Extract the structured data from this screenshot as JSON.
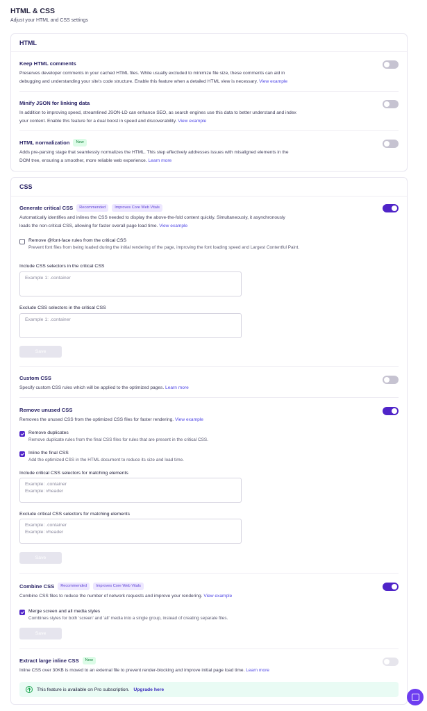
{
  "page": {
    "title": "HTML & CSS",
    "subtitle": "Adjust your HTML and CSS settings"
  },
  "html_section": {
    "title": "HTML",
    "options": [
      {
        "title": "Keep HTML comments",
        "desc_line1": "Preserves developer comments in your cached HTML files. While usually excluded to minimize file size, these comments can aid in",
        "desc_line2": "debugging and understanding your site's code structure. Enable this feature when a detailed HTML view is necessary.",
        "link": "View example",
        "enabled": false
      },
      {
        "title": "Minify JSON for linking data",
        "desc_line1": "In addition to improving speed, streamlined JSON-LD can enhance SEO, as search engines use this data to better understand and index",
        "desc_line2": "your content. Enable this feature for a dual boost in speed and discoverability.",
        "link": "View example",
        "enabled": false
      },
      {
        "title": "HTML normalization",
        "badge": "New",
        "desc_line1": "Adds pre-parsing stage that seamlessly normalizes the HTML. This step effectively addresses issues with misaligned elements in the",
        "desc_line2": "DOM tree, ensuring a smoother, more reliable web experience.",
        "link": "Learn more",
        "enabled": false
      }
    ]
  },
  "css_section": {
    "title": "CSS",
    "critical": {
      "title": "Generate critical CSS",
      "badge1": "Recommended",
      "badge2": "Improves Core Web Vitals",
      "desc_line1": "Automatically identifies and inlines the CSS needed to display the above-the-fold content quickly. Simultaneously, it asynchronously",
      "desc_line2": "loads the non-critical CSS, allowing for faster overall page load time.",
      "link": "View example",
      "enabled": true,
      "fontface_title": "Remove @font-face rules from the critical CSS",
      "fontface_desc": "Prevent font files from being loaded during the initial rendering of the page, improving the font loading speed and Largest Contentful Paint.",
      "fontface_checked": false,
      "include_label": "Include CSS selectors in the critical CSS",
      "include_placeholder": "Example 1: .container",
      "exclude_label": "Exclude CSS selectors in the critical CSS",
      "exclude_placeholder": "Example 1: .container",
      "save_label": "Save"
    },
    "custom": {
      "title": "Custom CSS",
      "desc": "Specify custom CSS rules which will be applied to the optimized pages.",
      "link": "Learn more",
      "enabled": false
    },
    "unused": {
      "title": "Remove unused CSS",
      "desc": "Removes the unused CSS from the optimized CSS files for faster rendering.",
      "link": "View example",
      "enabled": true,
      "dup_title": "Remove duplicates",
      "dup_desc": "Remove duplicate rules from the final CSS files for rules that are present in the critical CSS.",
      "dup_checked": true,
      "inline_title": "Inline the final CSS",
      "inline_desc": "Add the optimized CSS in the HTML document to reduce its size and load time.",
      "inline_checked": true,
      "include_label": "Include critical CSS selectors for matching elements",
      "include_placeholder": "Example: .container\nExample: #header",
      "exclude_label": "Exclude critical CSS selectors for matching elements",
      "exclude_placeholder": "Example: .container\nExample: #header",
      "save_label": "Save"
    },
    "combine": {
      "title": "Combine CSS",
      "badge1": "Recommended",
      "badge2": "Improves Core Web Vitals",
      "desc": "Combine CSS files to reduce the number of network requests and improve your rendering.",
      "link": "View example",
      "enabled": true,
      "merge_title": "Merge screen and all media styles",
      "merge_desc": "Combines styles for both 'screen' and 'all' media into a single group, instead of creating separate files.",
      "merge_checked": true,
      "save_label": "Save"
    },
    "extract": {
      "title": "Extract large inline CSS",
      "badge": "New",
      "desc": "Inline CSS over 30KB is moved to an external file to prevent render-blocking and improve initial page load time.",
      "link": "Learn more",
      "enabled": false,
      "pro_text": "This feature is available on Pro subscription.",
      "pro_link": "Upgrade here"
    }
  },
  "icons": {
    "pro_notice": "arrow-up-circle-icon",
    "chat": "chat-bubble-icon"
  },
  "colors": {
    "accent": "#4f24c8",
    "link": "#4f46e5",
    "toggle_off": "#c6c3d1",
    "pro_banner_bg": "#e9fbf4"
  }
}
